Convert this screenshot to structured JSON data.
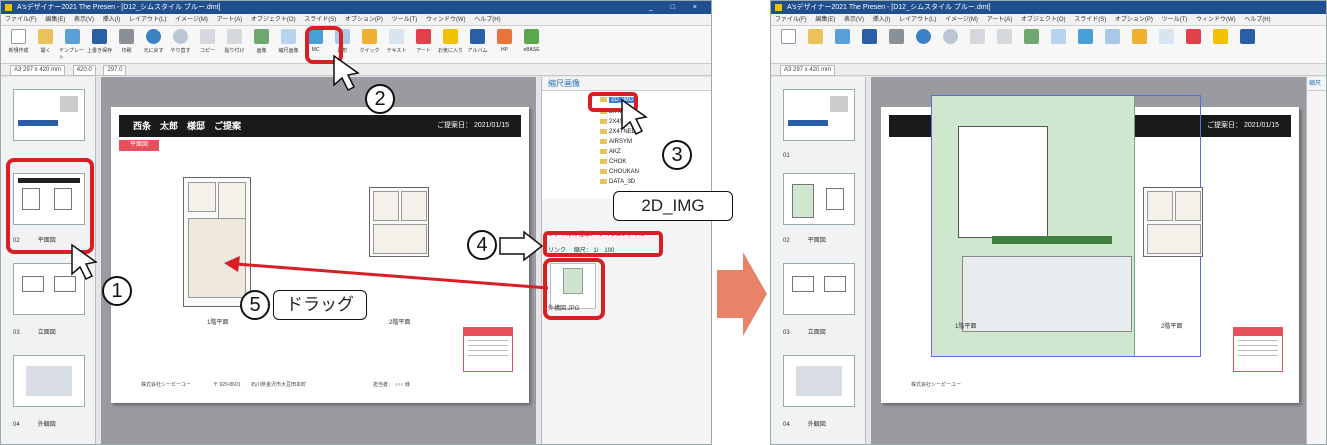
{
  "left": {
    "window_title": "A'sデザイナー2021 The Presen - [D12_シムスタイル ブルー.dmt]",
    "window_controls": "_ □ ×",
    "menu": [
      "ファイル(F)",
      "編集(E)",
      "表示(V)",
      "挿入(I)",
      "レイアウト(L)",
      "イメージ(M)",
      "アート(A)",
      "オブジェクト(O)",
      "スライド(S)",
      "オプション(P)",
      "ツール(T)",
      "ウィンドウ(W)",
      "ヘルプ(H)"
    ],
    "tools": [
      "新規作成",
      "開く",
      "テンプレート",
      "上書き保存",
      "印刷",
      "元に戻す",
      "やり直す",
      "コピー",
      "貼り付け",
      "画像",
      "縮尺画像",
      "MC",
      "図形",
      "クイック",
      "テキスト",
      "アート",
      "お気に入り",
      "アルバム",
      "HP",
      "eBASE"
    ],
    "paper_size": "A3 297 x 420 mm",
    "zoom_width": "420.0",
    "zoom_height": "297.0",
    "slides": [
      {
        "num": "",
        "name": ""
      },
      {
        "num": "02",
        "name": "平面図"
      },
      {
        "num": "03",
        "name": "立面図"
      },
      {
        "num": "04",
        "name": "外観図"
      }
    ],
    "page_header": "西条　太郎　様邸　ご提案",
    "page_date": "ご提案日： 2021/01/15",
    "plan_tag": "平面図",
    "floor1_label": "1階平面",
    "floor2_label": "2階平面",
    "footer_company": "株式会社シーピーユー",
    "footer_zip": "〒 920-8601",
    "footer_address": "石川県金沢市大豆田本町",
    "footer_staff": "担当者： ○○○ 様",
    "right_panel_title": "縮尺画像",
    "tree": [
      "2D_IMG",
      "2X4RB",
      "2X4STD",
      "2X4TNED",
      "AIRSYM",
      "AKZ",
      "CHOK",
      "CHOUKAN",
      "DATA_3D"
    ],
    "file_type_label": "ファイルの種類：",
    "file_type_value": "すべてのファイル",
    "link_label": "リンク",
    "scale_label": "縮尺：",
    "scale_value": "1/　100",
    "image_name": "外構図.JPG"
  },
  "right": {
    "window_title": "A'sデザイナー2021 The Presen - [D12_シムスタイル ブルー.dmt]",
    "menu": [
      "ファイル(F)",
      "編集(E)",
      "表示(V)",
      "挿入(I)",
      "レイアウト(L)",
      "イメージ(M)",
      "アート(A)",
      "オブジェクト(O)",
      "スライド(S)",
      "オプション(P)",
      "ツール(T)",
      "ウィンドウ(W)",
      "ヘルプ(H)"
    ],
    "paper_size": "A3 297 x 420 mm",
    "slides": [
      {
        "num": "01",
        "name": ""
      },
      {
        "num": "02",
        "name": "平面図"
      },
      {
        "num": "03",
        "name": "立面図"
      },
      {
        "num": "04",
        "name": "外観図"
      }
    ],
    "page_date": "ご提案日： 2021/01/15",
    "floor1_label": "1階平面",
    "floor2_label": "2階平面",
    "footer_company": "株式会社シーピーユー",
    "right_panel_title": "縮尺"
  },
  "callouts": {
    "c1": "1",
    "c2": "2",
    "c3": "3",
    "c4": "4",
    "c5": "5",
    "label_2d_img": "2D_IMG",
    "label_drag": "ドラッグ"
  },
  "colors": {
    "accent_red": "#d81f26",
    "arrow_orange": "#e8836a",
    "title_blue": "#1f4f8f",
    "header_black": "#1a1a1a",
    "plan_tag_red": "#e6505a",
    "green_plan": "#cfe6cf"
  }
}
